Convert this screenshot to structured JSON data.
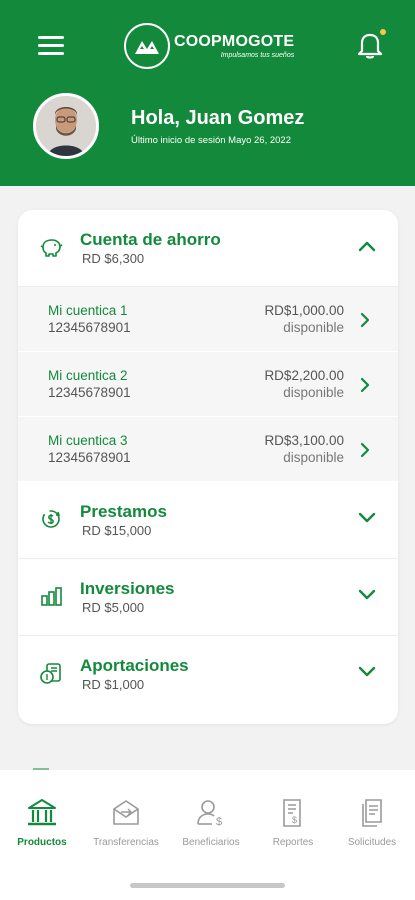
{
  "header": {
    "logo_name": "COOPMOGOTE",
    "logo_tagline": "Impulsamos tus sueños",
    "greeting": "Hola, Juan Gomez",
    "last_login": "Último inicio de sesión Mayo 26, 2022",
    "notification_dot_color": "#f2c94c"
  },
  "colors": {
    "brand": "#138a3b",
    "background": "#f2f2f2"
  },
  "sections": [
    {
      "title": "Cuenta de ahorro",
      "amount": "RD $6,300",
      "icon": "piggy-bank-icon",
      "expanded": true,
      "accounts": [
        {
          "name": "Mi cuentica 1",
          "number": "12345678901",
          "balance": "RD$1,000.00",
          "status": "disponible"
        },
        {
          "name": "Mi cuentica 2",
          "number": "12345678901",
          "balance": "RD$2,200.00",
          "status": "disponible"
        },
        {
          "name": "Mi cuentica 3",
          "number": "12345678901",
          "balance": "RD$3,100.00",
          "status": "disponible"
        }
      ]
    },
    {
      "title": "Prestamos",
      "amount": "RD $15,000",
      "icon": "loan-icon",
      "expanded": false
    },
    {
      "title": "Inversiones",
      "amount": "RD $5,000",
      "icon": "investment-icon",
      "expanded": false
    },
    {
      "title": "Aportaciones",
      "amount": "RD $1,000",
      "icon": "contribution-icon",
      "expanded": false
    }
  ],
  "tabs": [
    {
      "label": "Productos",
      "icon": "bank-icon",
      "active": true
    },
    {
      "label": "Transferencias",
      "icon": "transfer-icon",
      "active": false
    },
    {
      "label": "Beneficiarios",
      "icon": "beneficiary-icon",
      "active": false
    },
    {
      "label": "Reportes",
      "icon": "report-icon",
      "active": false
    },
    {
      "label": "Solicitudes",
      "icon": "requests-icon",
      "active": false
    }
  ]
}
